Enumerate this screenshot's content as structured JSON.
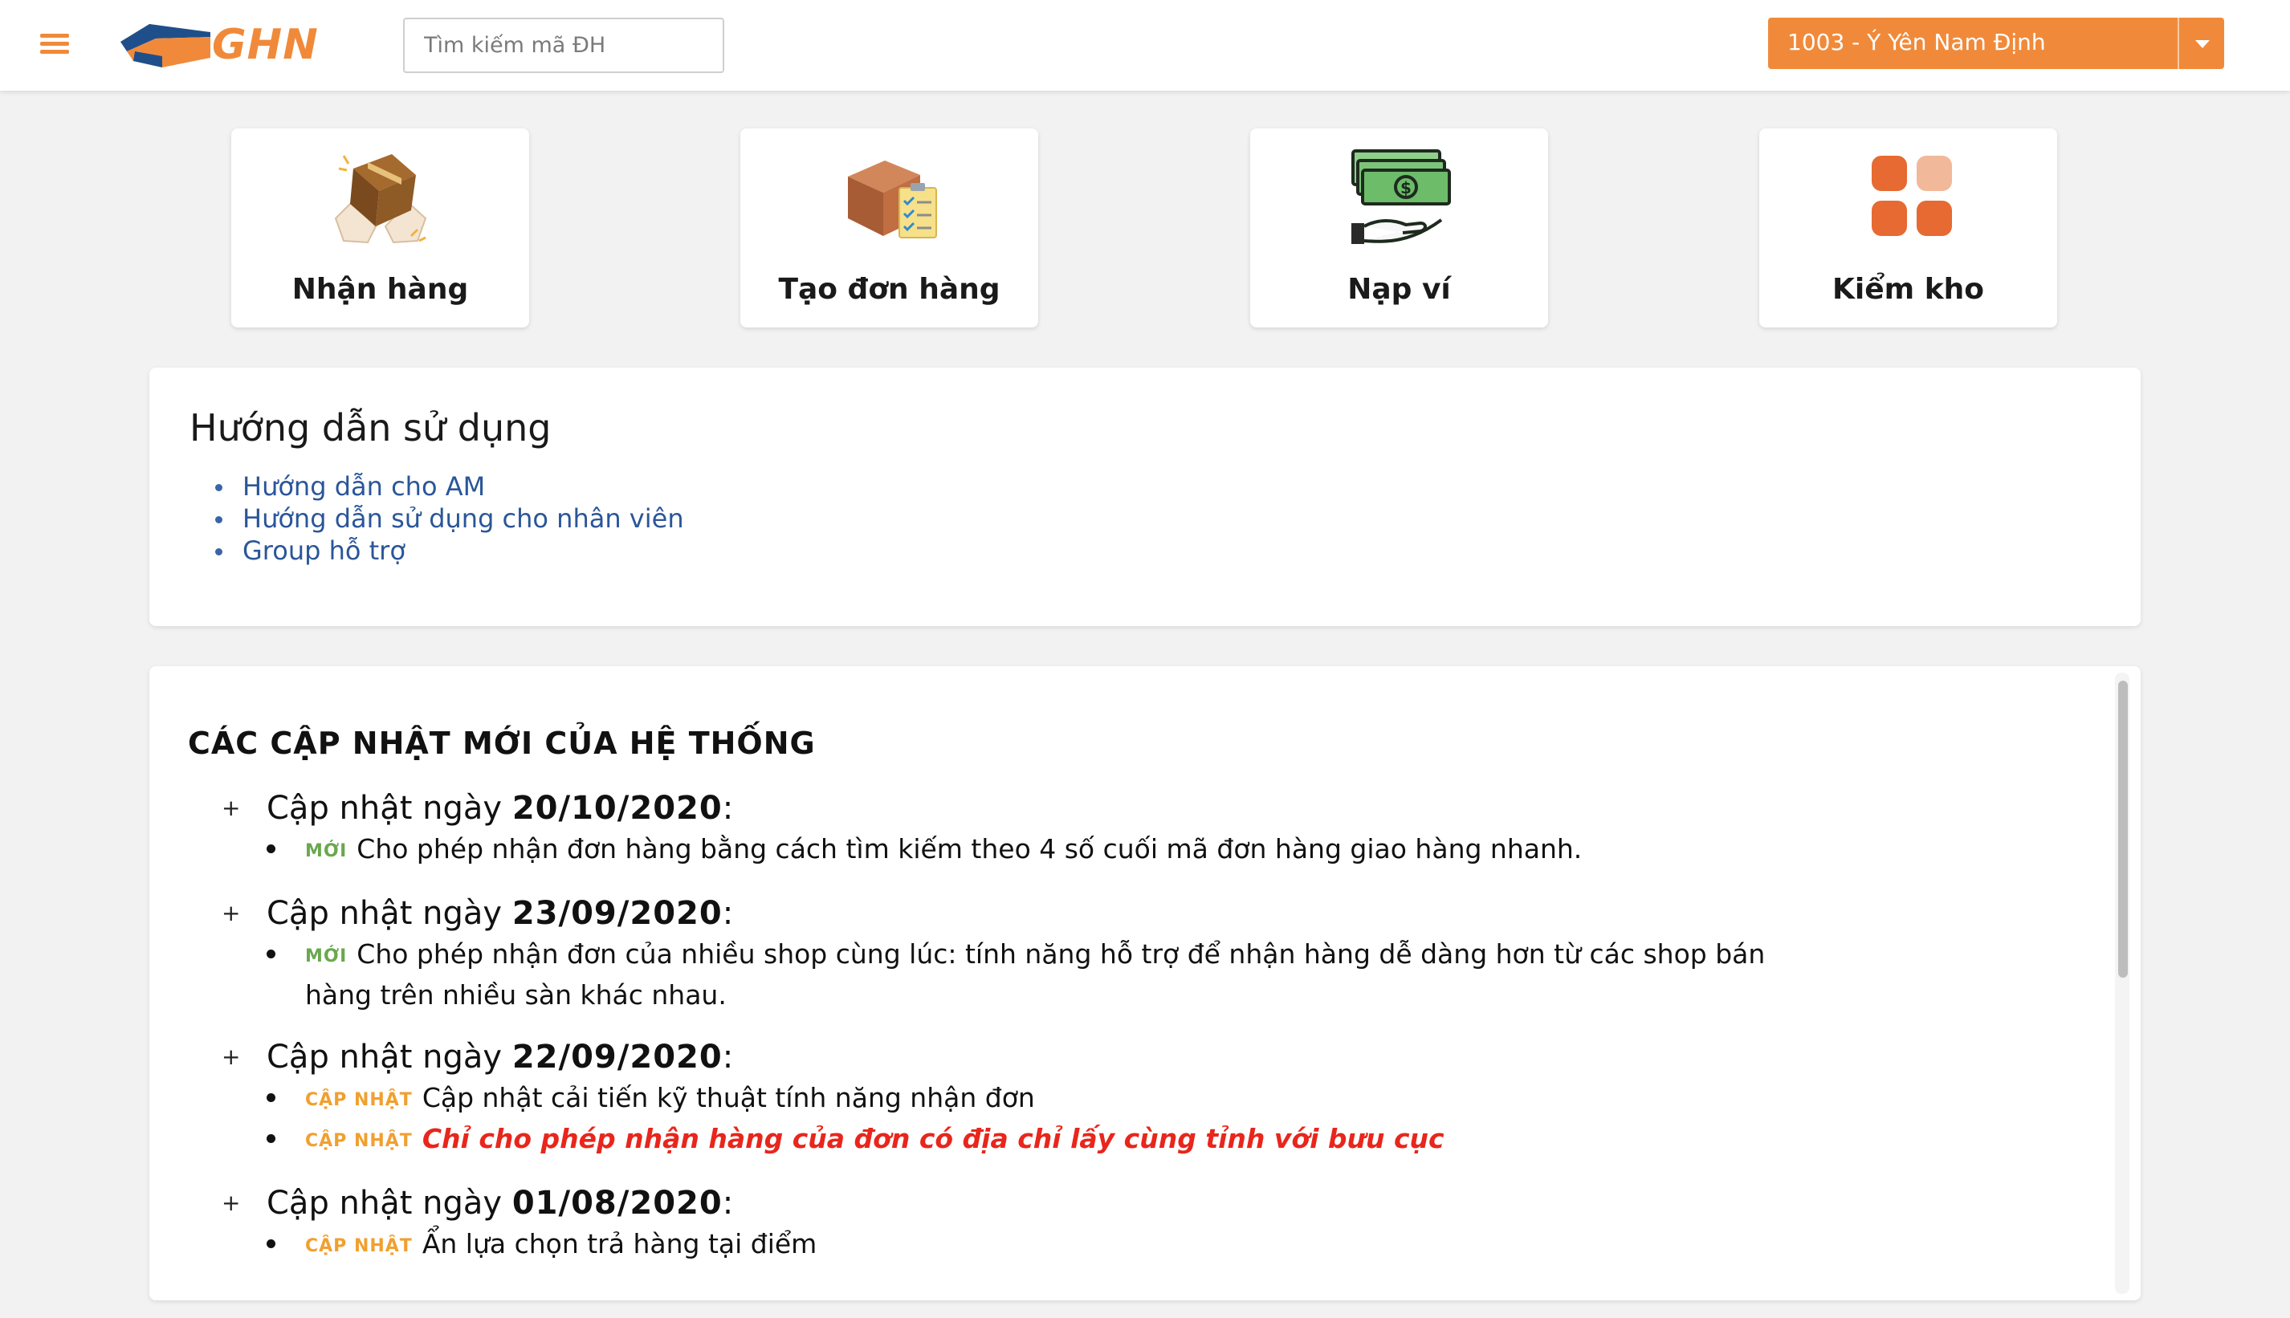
{
  "header": {
    "logo_text": "GHN",
    "search_placeholder": "Tìm kiếm mã ĐH",
    "branch_label": "1003 - Ý Yên Nam Định"
  },
  "tiles": [
    {
      "label": "Nhận hàng",
      "icon": "receive-package-icon"
    },
    {
      "label": "Tạo đơn hàng",
      "icon": "create-order-icon"
    },
    {
      "label": "Nạp ví",
      "icon": "wallet-topup-icon"
    },
    {
      "label": "Kiểm kho",
      "icon": "inventory-grid-icon"
    }
  ],
  "guide": {
    "title": "Hướng dẫn sử dụng",
    "links": [
      "Hướng dẫn cho AM",
      "Hướng dẫn sử dụng cho nhân viên",
      "Group hỗ trợ"
    ]
  },
  "updates": {
    "title": "CÁC CẬP NHẬT MỚI CỦA HỆ THỐNG",
    "prefix": "Cập nhật ngày",
    "tag_new": "MỚI",
    "tag_update": "CẬP NHẬT",
    "items": [
      {
        "date": "20/10/2020",
        "entries": [
          {
            "tag": "MỚI",
            "text": "Cho phép nhận đơn hàng bằng cách tìm kiếm theo 4 số cuối mã đơn hàng giao hàng nhanh."
          }
        ]
      },
      {
        "date": "23/09/2020",
        "entries": [
          {
            "tag": "MỚI",
            "text": "Cho phép nhận đơn của nhiều shop cùng lúc: tính năng hỗ trợ để nhận hàng dễ dàng hơn từ các shop bán hàng trên nhiều sàn khác nhau."
          }
        ]
      },
      {
        "date": "22/09/2020",
        "entries": [
          {
            "tag": "CẬP NHẬT",
            "text": "Cập nhật cải tiến kỹ thuật tính năng nhận đơn"
          },
          {
            "tag": "CẬP NHẬT",
            "text": "Chỉ cho phép nhận hàng của đơn có địa chỉ lấy cùng tỉnh với bưu cục"
          }
        ]
      },
      {
        "date": "01/08/2020",
        "entries": [
          {
            "tag": "CẬP NHẬT",
            "text": "Ẩn lựa chọn trả hàng tại điểm"
          }
        ]
      }
    ]
  },
  "colors": {
    "brand_orange": "#f08a3a",
    "link_blue": "#2a5699",
    "tag_new_green": "#6aa84f",
    "tag_update_orange": "#f0a030",
    "highlight_red": "#e8261c"
  }
}
